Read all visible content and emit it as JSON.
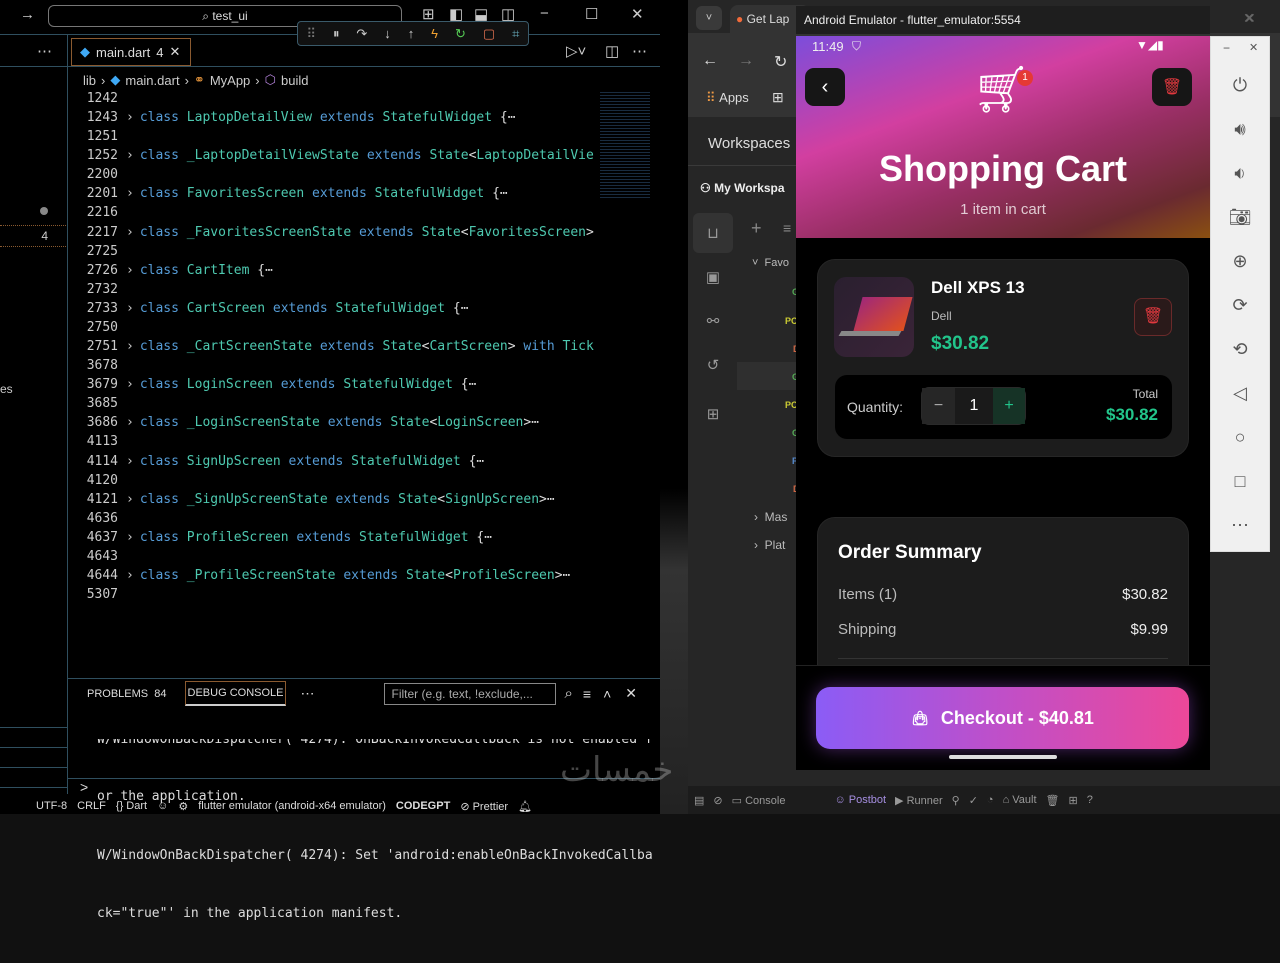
{
  "vscode": {
    "search": "test_ui",
    "tab": {
      "label": "main.dart",
      "badge": "4"
    },
    "breadcrumb": [
      "lib",
      "main.dart",
      "MyApp",
      "build"
    ],
    "side_badge": "4",
    "side_partial_text": "es",
    "code_lines": [
      {
        "n": "1242",
        "parts": []
      },
      {
        "n": "1243",
        "parts": [
          [
            "class ",
            "kw"
          ],
          [
            "LaptopDetailView ",
            "cls"
          ],
          [
            "extends ",
            "kw"
          ],
          [
            "StatefulWidget ",
            "cls"
          ],
          [
            "{⋯",
            "pu"
          ]
        ]
      },
      {
        "n": "1251",
        "parts": []
      },
      {
        "n": "1252",
        "parts": [
          [
            "class ",
            "kw"
          ],
          [
            "_LaptopDetailViewState ",
            "cls"
          ],
          [
            "extends ",
            "kw"
          ],
          [
            "State",
            "cls"
          ],
          [
            "<",
            "pu"
          ],
          [
            "LaptopDetailVie",
            "cls"
          ]
        ]
      },
      {
        "n": "2200",
        "parts": []
      },
      {
        "n": "2201",
        "parts": [
          [
            "class ",
            "kw"
          ],
          [
            "FavoritesScreen ",
            "cls"
          ],
          [
            "extends ",
            "kw"
          ],
          [
            "StatefulWidget ",
            "cls"
          ],
          [
            "{⋯",
            "pu"
          ]
        ]
      },
      {
        "n": "2216",
        "parts": []
      },
      {
        "n": "2217",
        "parts": [
          [
            "class ",
            "kw"
          ],
          [
            "_FavoritesScreenState ",
            "cls"
          ],
          [
            "extends ",
            "kw"
          ],
          [
            "State",
            "cls"
          ],
          [
            "<",
            "pu"
          ],
          [
            "FavoritesScreen",
            "cls"
          ],
          [
            ">",
            "pu"
          ]
        ]
      },
      {
        "n": "2725",
        "parts": []
      },
      {
        "n": "2726",
        "parts": [
          [
            "class ",
            "kw"
          ],
          [
            "CartItem ",
            "cls"
          ],
          [
            "{⋯",
            "pu"
          ]
        ]
      },
      {
        "n": "2732",
        "parts": []
      },
      {
        "n": "2733",
        "parts": [
          [
            "class ",
            "kw"
          ],
          [
            "CartScreen ",
            "cls"
          ],
          [
            "extends ",
            "kw"
          ],
          [
            "StatefulWidget ",
            "cls"
          ],
          [
            "{⋯",
            "pu"
          ]
        ]
      },
      {
        "n": "2750",
        "parts": []
      },
      {
        "n": "2751",
        "parts": [
          [
            "class ",
            "kw"
          ],
          [
            "_CartScreenState ",
            "cls"
          ],
          [
            "extends ",
            "kw"
          ],
          [
            "State",
            "cls"
          ],
          [
            "<",
            "pu"
          ],
          [
            "CartScreen",
            "cls"
          ],
          [
            "> ",
            "pu"
          ],
          [
            "with ",
            "kw"
          ],
          [
            "Tick",
            "cls"
          ]
        ]
      },
      {
        "n": "3678",
        "parts": []
      },
      {
        "n": "3679",
        "parts": [
          [
            "class ",
            "kw"
          ],
          [
            "LoginScreen ",
            "cls"
          ],
          [
            "extends ",
            "kw"
          ],
          [
            "StatefulWidget ",
            "cls"
          ],
          [
            "{⋯",
            "pu"
          ]
        ]
      },
      {
        "n": "3685",
        "parts": []
      },
      {
        "n": "3686",
        "parts": [
          [
            "class ",
            "kw"
          ],
          [
            "_LoginScreenState ",
            "cls"
          ],
          [
            "extends ",
            "kw"
          ],
          [
            "State",
            "cls"
          ],
          [
            "<",
            "pu"
          ],
          [
            "LoginScreen",
            "cls"
          ],
          [
            ">⋯",
            "pu"
          ]
        ]
      },
      {
        "n": "4113",
        "parts": []
      },
      {
        "n": "4114",
        "parts": [
          [
            "class ",
            "kw"
          ],
          [
            "SignUpScreen ",
            "cls"
          ],
          [
            "extends ",
            "kw"
          ],
          [
            "StatefulWidget ",
            "cls"
          ],
          [
            "{⋯",
            "pu"
          ]
        ]
      },
      {
        "n": "4120",
        "parts": []
      },
      {
        "n": "4121",
        "parts": [
          [
            "class ",
            "kw"
          ],
          [
            "_SignUpScreenState ",
            "cls"
          ],
          [
            "extends ",
            "kw"
          ],
          [
            "State",
            "cls"
          ],
          [
            "<",
            "pu"
          ],
          [
            "SignUpScreen",
            "cls"
          ],
          [
            ">⋯",
            "pu"
          ]
        ]
      },
      {
        "n": "4636",
        "parts": []
      },
      {
        "n": "4637",
        "parts": [
          [
            "class ",
            "kw"
          ],
          [
            "ProfileScreen ",
            "cls"
          ],
          [
            "extends ",
            "kw"
          ],
          [
            "StatefulWidget ",
            "cls"
          ],
          [
            "{⋯",
            "pu"
          ]
        ]
      },
      {
        "n": "4643",
        "parts": []
      },
      {
        "n": "4644",
        "parts": [
          [
            "class ",
            "kw"
          ],
          [
            "_ProfileScreenState ",
            "cls"
          ],
          [
            "extends ",
            "kw"
          ],
          [
            "State",
            "cls"
          ],
          [
            "<",
            "pu"
          ],
          [
            "ProfileScreen",
            "cls"
          ],
          [
            ">⋯",
            "pu"
          ]
        ]
      },
      {
        "n": "5307",
        "parts": []
      }
    ],
    "panel": {
      "problems": "PROBLEMS",
      "problems_count": "84",
      "debug_console": "DEBUG CONSOLE",
      "filter_placeholder": "Filter (e.g. text, !exclude,..."
    },
    "console_lines": [
      "W/WindowOnBackDispatcher( 4274): OnBackInvokedCallback is not enabled f",
      "or the application.",
      "W/WindowOnBackDispatcher( 4274): Set 'android:enableOnBackInvokedCallba",
      "ck=\"true\"' in the application manifest."
    ],
    "console_prompt": ">",
    "status": {
      "encoding": "UTF-8",
      "eol": "CRLF",
      "language": "{} Dart",
      "device": "flutter emulator (android-x64 emulator)",
      "codegpt": "CODEGPT",
      "prettier": "Prettier"
    }
  },
  "browser": {
    "tab": "Get Lap",
    "apps": "Apps",
    "workspaces": "Workspaces",
    "my_workspace": "My Workspa",
    "tree": {
      "favorites": "Favo",
      "items": [
        "G",
        "PC",
        "D",
        "G",
        "PC",
        "G",
        "P",
        "D"
      ],
      "collapsed": [
        "Mas",
        "Plat"
      ]
    },
    "status": {
      "console": "Console",
      "postbot": "Postbot",
      "runner": "Runner",
      "vault": "Vault"
    }
  },
  "emulator": {
    "title": "Android Emulator - flutter_emulator:5554",
    "time": "11:49",
    "cart_badge": "1",
    "title_text": "Shopping Cart",
    "subtitle": "1 item in cart",
    "item": {
      "name": "Dell XPS 13",
      "brand": "Dell",
      "price": "$30.82",
      "quantity_label": "Quantity:",
      "quantity": "1",
      "total_label": "Total",
      "total": "$30.82"
    },
    "summary": {
      "title": "Order Summary",
      "rows": [
        {
          "label": "Items (1)",
          "value": "$30.82"
        },
        {
          "label": "Shipping",
          "value": "$9.99"
        }
      ]
    },
    "checkout": "Checkout - $40.81",
    "colors": {
      "accent_green": "#22c58b",
      "delete_red": "#e0383e",
      "gradient_start": "#8b5cf6",
      "gradient_end": "#ec4899"
    }
  },
  "watermark": "خمسات"
}
